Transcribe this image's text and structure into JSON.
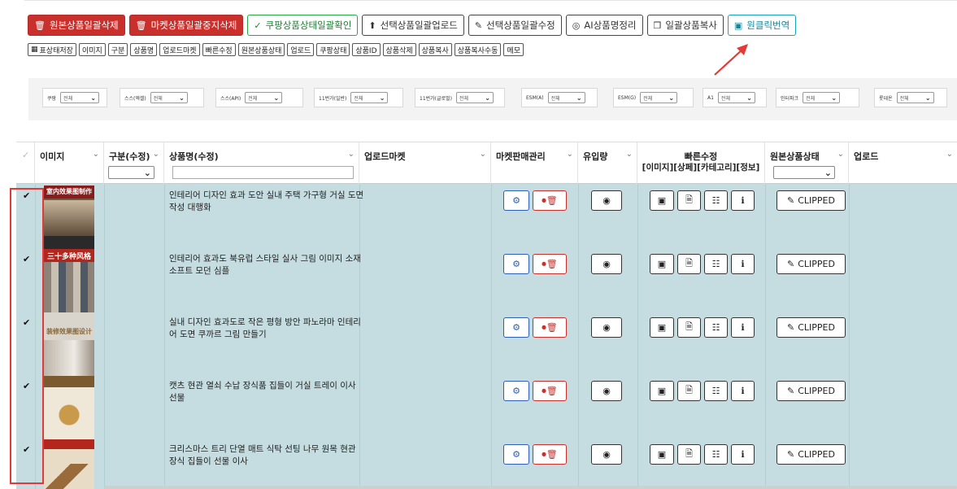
{
  "toolbar": {
    "buttons": [
      {
        "label": "원본상품일괄삭제",
        "icon": "trash-icon",
        "style": "red"
      },
      {
        "label": "마켓상품일괄중지삭제",
        "icon": "trash-icon",
        "style": "red"
      },
      {
        "label": "쿠팡상품상태일괄확인",
        "icon": "check-icon",
        "style": "green"
      },
      {
        "label": "선택상품일괄업로드",
        "icon": "upload-icon",
        "style": "dark"
      },
      {
        "label": "선택상품일괄수정",
        "icon": "edit-icon",
        "style": "dark"
      },
      {
        "label": "AI상품명정리",
        "icon": "ai-icon",
        "style": "dark"
      },
      {
        "label": "일괄상품복사",
        "icon": "copy-icon",
        "style": "dark"
      },
      {
        "label": "원클릭번역",
        "icon": "translate-icon",
        "style": "teal"
      }
    ]
  },
  "column_toggles": [
    "표상태저장",
    "이미지",
    "구분",
    "상품명",
    "업로드마켓",
    "빠른수정",
    "원본상품상태",
    "업로드",
    "쿠팡상태",
    "상품ID",
    "상품삭제",
    "상품복사",
    "상품복사수동",
    "메모"
  ],
  "filters": [
    {
      "label": "쿠팡",
      "value": "전체"
    },
    {
      "label": "스스(엑셀)",
      "value": "전체"
    },
    {
      "label": "스스(API)",
      "value": "전체"
    },
    {
      "label": "11번가(일반)",
      "value": "전체"
    },
    {
      "label": "11번가(글로벌)",
      "value": "전체"
    },
    {
      "label": "ESM(A)",
      "value": "전체"
    },
    {
      "label": "ESM(G)",
      "value": "전체"
    },
    {
      "label": "A1",
      "value": "전체"
    },
    {
      "label": "인터파크",
      "value": "전체"
    },
    {
      "label": "롯데온",
      "value": "전체"
    }
  ],
  "table": {
    "headers": {
      "image": "이미지",
      "category": "구분(수정)",
      "name": "상품명(수정)",
      "upload_market": "업로드마켓",
      "market_mgmt": "마켓판매관리",
      "traffic": "유입량",
      "quick_edit_1": "빠른수정",
      "quick_edit_2": "[이미지][상페][카테고리][정보]",
      "origin_status": "원본상품상태",
      "upload": "업로드"
    },
    "rows": [
      {
        "name": "인테리어 디자인 효과 도안 실내 주택 가구형 거실 도면 작성 대행화",
        "thumb_caption": "室内效果图制作",
        "status": "CLIPPED",
        "checked": true
      },
      {
        "name": "인테리어 효과도 북유럽 스타일 실사 그림 이미지 소재 소프트 모던 심플",
        "thumb_caption": "三十多种风格",
        "status": "CLIPPED",
        "checked": true
      },
      {
        "name": "실내 디자인 효과도로 작은 평형 방안 파노라마 인테리어 도면 쿠까르 그림 만들기",
        "thumb_caption": "装修效果图设计",
        "status": "CLIPPED",
        "checked": true
      },
      {
        "name": "캣츠 현관 열쇠 수납 장식품 집들이 거실 트레이 이사 선물",
        "thumb_caption": "",
        "status": "CLIPPED",
        "checked": true
      },
      {
        "name": "크리스마스 트리 단열 매트 식탁 선팅 나무 원목 현관 장식 집들이 선물 이사",
        "thumb_caption": "",
        "status": "CLIPPED",
        "checked": true
      }
    ]
  },
  "colors": {
    "row_bg": "#c5dde0",
    "red": "#c9302c",
    "blue": "#2c5fb8",
    "green": "#28a745",
    "teal": "#17a2b8",
    "highlight": "#e03a3a"
  }
}
